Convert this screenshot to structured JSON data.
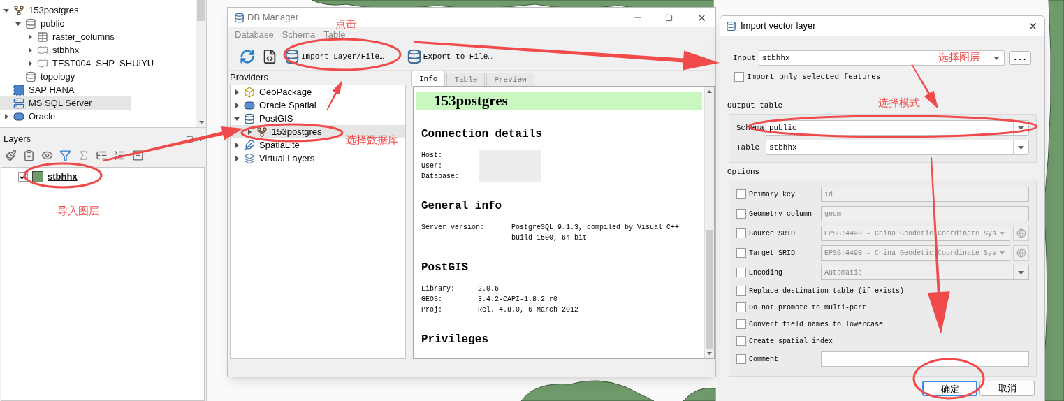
{
  "browser_tree": [
    {
      "label": "153postgres",
      "kind": "connection",
      "expanded": true,
      "selected": false,
      "children": [
        {
          "label": "public",
          "kind": "schema",
          "expanded": true,
          "selected": false,
          "children": [
            {
              "label": "raster_columns",
              "kind": "table",
              "expanded": false,
              "selected": false
            },
            {
              "label": "stbhhx",
              "kind": "polygon",
              "expanded": false,
              "selected": false
            },
            {
              "label": "TEST004_SHP_SHUIYU",
              "kind": "polygon",
              "expanded": false,
              "selected": false
            }
          ]
        },
        {
          "label": "topology",
          "kind": "schema",
          "selected": false
        }
      ]
    },
    {
      "label": "SAP HANA",
      "kind": "hana",
      "selected": false
    },
    {
      "label": "MS SQL Server",
      "kind": "mssql",
      "selected": true
    },
    {
      "label": "Oracle",
      "kind": "oracle",
      "expanded": false,
      "selected": false
    }
  ],
  "layers_panel": {
    "title": "Layers",
    "layers": [
      {
        "name": "stbhhx",
        "checked": true,
        "color": "#6f9a6b"
      }
    ]
  },
  "db_manager": {
    "title": "DB Manager",
    "menu": [
      "Database",
      "Schema",
      "Table"
    ],
    "toolbar": [
      {
        "kind": "refresh"
      },
      {
        "kind": "sql"
      },
      {
        "kind": "import",
        "label": "Import Layer/File…"
      },
      {
        "kind": "export",
        "label": "Export to File…"
      }
    ],
    "providers_title": "Providers",
    "providers": [
      {
        "label": "GeoPackage",
        "kind": "geopackage",
        "expanded": false,
        "selected": false
      },
      {
        "label": "Oracle Spatial",
        "kind": "oracle",
        "expanded": false,
        "selected": false
      },
      {
        "label": "PostGIS",
        "kind": "postgis",
        "expanded": true,
        "selected": false,
        "children": [
          {
            "label": "153postgres",
            "kind": "connection",
            "expanded": false,
            "selected": true
          }
        ]
      },
      {
        "label": "SpatiaLite",
        "kind": "spatialite",
        "expanded": false,
        "selected": false
      },
      {
        "label": "Virtual Layers",
        "kind": "virtual",
        "expanded": false,
        "selected": false
      }
    ],
    "tabs": [
      {
        "label": "Info",
        "selected": true
      },
      {
        "label": "Table",
        "selected": false
      },
      {
        "label": "Preview",
        "selected": false
      }
    ],
    "info": {
      "title": "153postgres",
      "sections": [
        {
          "kind": "connection",
          "heading": "Connection details",
          "rows": [
            {
              "label": "Host:",
              "redacted": true
            },
            {
              "label": "User:",
              "redacted": true
            },
            {
              "label": "Database:",
              "redacted": true
            }
          ]
        },
        {
          "kind": "general",
          "heading": "General info",
          "rows": [
            {
              "label": "Server version:",
              "value": "PostgreSQL 9.1.3, compiled by Visual C++ build 1500, 64-bit"
            }
          ]
        },
        {
          "kind": "postgis",
          "heading": "PostGIS",
          "rows": [
            {
              "label": "Library:",
              "value": "2.0.6"
            },
            {
              "label": "GEOS:",
              "value": "3.4.2-CAPI-1.8.2 r0"
            },
            {
              "label": "Proj:",
              "value": "Rel. 4.8.0, 6 March 2012"
            }
          ]
        },
        {
          "kind": "privileges",
          "heading": "Privileges"
        }
      ]
    }
  },
  "import_dialog": {
    "title": "Import vector layer",
    "input": {
      "label": "Input",
      "value": "stbhhx",
      "browse": "..."
    },
    "selected_only": {
      "label": "Import only selected features",
      "checked": false
    },
    "output_title": "Output table",
    "schema": {
      "label": "Schema",
      "value": "public"
    },
    "table": {
      "label": "Table",
      "value": "stbhhx"
    },
    "options_title": "Options",
    "options": [
      {
        "kind": "text",
        "label": "Primary key",
        "checked": false,
        "disabled": true,
        "value": "id"
      },
      {
        "kind": "text",
        "label": "Geometry column",
        "checked": false,
        "disabled": true,
        "value": "geom"
      },
      {
        "kind": "srid",
        "label": "Source SRID",
        "checked": false,
        "disabled": true,
        "value": "EPSG:4490 - China Geodetic Coordinate Sys"
      },
      {
        "kind": "srid",
        "label": "Target SRID",
        "checked": false,
        "disabled": true,
        "value": "EPSG:4490 - China Geodetic Coordinate Sys"
      },
      {
        "kind": "combo",
        "label": "Encoding",
        "checked": false,
        "disabled": true,
        "value": "Automatic"
      },
      {
        "kind": "check",
        "label": "Replace destination table (if exists)",
        "checked": false
      },
      {
        "kind": "check",
        "label": "Do not promote to multi-part",
        "checked": false
      },
      {
        "kind": "check",
        "label": "Convert field names to lowercase",
        "checked": false
      },
      {
        "kind": "check",
        "label": "Create spatial index",
        "checked": false
      },
      {
        "kind": "text",
        "label": "Comment",
        "checked": false
      }
    ],
    "buttons": [
      {
        "label": "确定",
        "default": true
      },
      {
        "label": "取消",
        "default": false
      }
    ]
  },
  "annotations": [
    "点击",
    "选择数据库",
    "导入图层",
    "选择图层",
    "选择模式"
  ]
}
